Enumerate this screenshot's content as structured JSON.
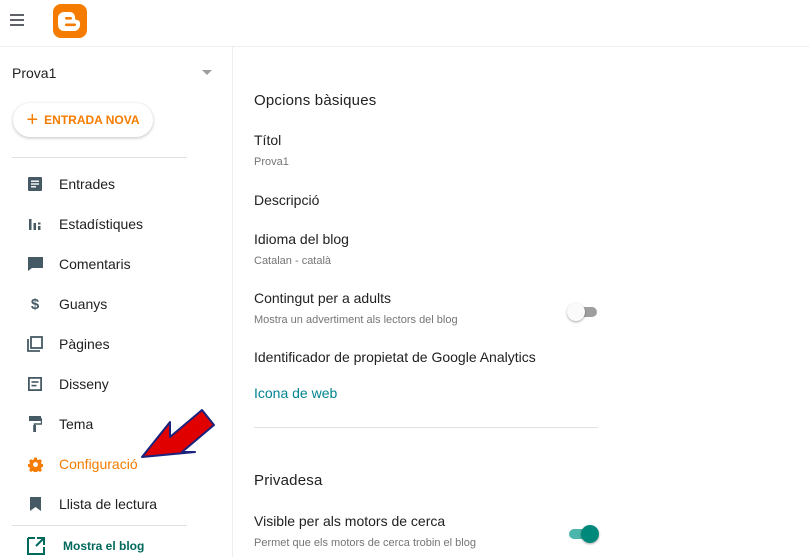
{
  "header": {
    "menu_icon": "hamburger-menu-icon",
    "logo_icon": "blogger-logo-icon",
    "brand_color": "#f57c00"
  },
  "sidebar": {
    "blog_name": "Prova1",
    "new_post_label": "ENTRADA NOVA",
    "items": [
      {
        "label": "Entrades",
        "icon": "posts-icon"
      },
      {
        "label": "Estadístiques",
        "icon": "stats-icon"
      },
      {
        "label": "Comentaris",
        "icon": "comments-icon"
      },
      {
        "label": "Guanys",
        "icon": "dollar-icon"
      },
      {
        "label": "Pàgines",
        "icon": "pages-icon"
      },
      {
        "label": "Disseny",
        "icon": "layout-icon"
      },
      {
        "label": "Tema",
        "icon": "paint-roller-icon"
      },
      {
        "label": "Configuració",
        "icon": "gear-icon",
        "active": true
      },
      {
        "label": "Llista de lectura",
        "icon": "bookmark-icon"
      }
    ],
    "view_blog_label": "Mostra el blog"
  },
  "settings": {
    "basic_title": "Opcions bàsiques",
    "title_label": "Títol",
    "title_value": "Prova1",
    "description_label": "Descripció",
    "language_label": "Idioma del blog",
    "language_value": "Catalan - català",
    "adult_label": "Contingut per a adults",
    "adult_help": "Mostra un advertiment als lectors del blog",
    "adult_enabled": false,
    "analytics_label": "Identificador de propietat de Google Analytics",
    "favicon_link": "Icona de web",
    "privacy_title": "Privadesa",
    "search_visible_label": "Visible per als motors de cerca",
    "search_visible_help": "Permet que els motors de cerca trobin el blog",
    "search_visible_enabled": true,
    "accent_color": "#00897b"
  },
  "annotation": {
    "arrow_color": "#e00000",
    "arrow_points_to": "Configuració"
  }
}
